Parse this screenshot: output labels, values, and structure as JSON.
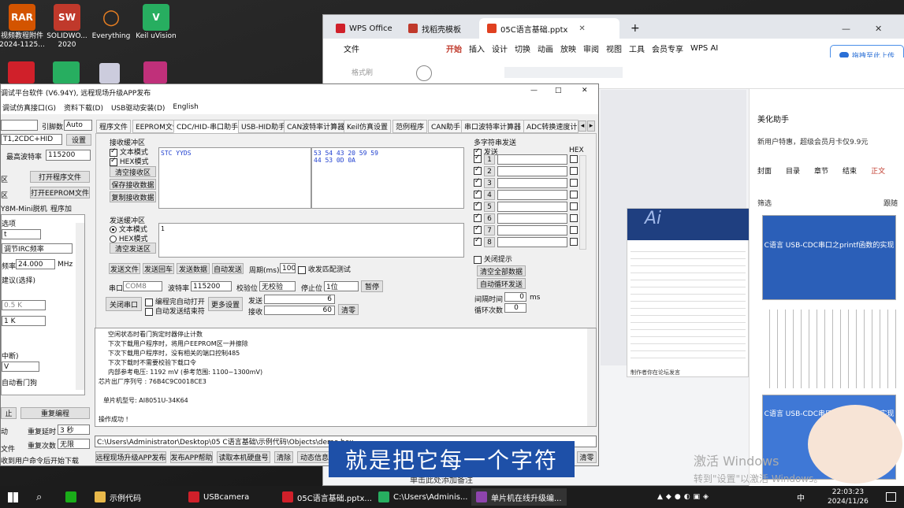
{
  "desktop": {
    "icons": [
      {
        "label": "视频教程附件\n2024-1125...",
        "color": "#d35400",
        "glyph": "RAR"
      },
      {
        "label": "SOLIDWO...\n2020",
        "color": "#c0392b",
        "glyph": "SW"
      },
      {
        "label": "Everything",
        "color": "#e67e22",
        "glyph": "Q"
      },
      {
        "label": "Keil uVision",
        "color": "#27ae60",
        "glyph": "V"
      }
    ]
  },
  "wps": {
    "tabs": [
      {
        "label": "WPS Office",
        "color": "#d0202a"
      },
      {
        "label": "找稻壳模板",
        "color": "#c0392b"
      },
      {
        "label": "05C语言基础.pptx",
        "color": "#e04020"
      }
    ],
    "menu": [
      "文件",
      "开始",
      "插入",
      "设计",
      "切换",
      "动画",
      "放映",
      "审阅",
      "视图",
      "工具",
      "会员专享",
      "WPS AI"
    ],
    "upload_button": "拖拽至此上传",
    "format_brush": "格式刷",
    "panel_title": "美化助手",
    "promo": "新用户特惠，超级会员月卡仅9.9元",
    "panel_tabs": [
      "封面",
      "目录",
      "章节",
      "结束",
      "正文"
    ],
    "filter": "筛选",
    "follow": "跟随",
    "thumb1": "C语言 USB-CDC串口之printf函数的实现",
    "thumb2": "C语言 USB-CDC串口之printf函数的实现",
    "add_note": "单击此处添加备注",
    "activate1": "激活 Windows",
    "activate2": "转到\"设置\"以激活 Windows。",
    "slide_text": "Ai",
    "slide_caption": "制作者你在论坛发言"
  },
  "stc": {
    "title": "调试平台软件 (V6.94Y), 远程现场升级APP发布",
    "menu": [
      "调试仿真接口(G)",
      "资料下载(D)",
      "USB驱动安装(D)",
      "English"
    ],
    "left": {
      "lead_count_label": "引脚数",
      "lead_count_value": "Auto",
      "port_value": "T1,2CDC+HID",
      "settings_button": "设置",
      "max_baud_label": "最高波特率",
      "max_baud_value": "115200",
      "open_program": "打开程序文件",
      "open_eeprom": "打开EEPROM文件",
      "mini_label": "Y8M-Mini脱机",
      "program_label": "程序加",
      "options_label": "选项",
      "irc_label": "调节IRC频率",
      "freq_label": "频率",
      "freq_value": "24.000",
      "freq_unit": "MHz",
      "suggest_label": "建议(选择)",
      "v1": "0.5 K",
      "v2": "1 K",
      "interrupt_label": "中断)",
      "vv": "V",
      "auto_label": "自动看门狗",
      "repeat_prog": "重复编程",
      "repeat_delay_label": "重复延时",
      "repeat_delay_value": "3 秒",
      "repeat_count_label": "重复次数",
      "repeat_count_value": "无限",
      "remote_label": "文件",
      "send_cmd": "收到用户命令后开始下载",
      "move_label": "动",
      "stop_label": "止"
    },
    "tabs": [
      "程序文件",
      "EEPROM文件",
      "CDC/HID-串口助手",
      "USB-HID助手",
      "CAN波特率计算器",
      "Keil仿真设置",
      "范例程序",
      "CAN助手",
      "串口波特率计算器",
      "ADC转换速度计算"
    ],
    "recv": {
      "title": "接收缓冲区",
      "text_mode": "文本模式",
      "hex_mode": "HEX模式",
      "clear": "清空接收区",
      "save": "保存接收数据",
      "copy": "复制接收数据",
      "text_content": "STC YYDS",
      "hex_line1": "53 54 43 20 59 59",
      "hex_line2": "44 53 0D 0A"
    },
    "send": {
      "title": "发送缓冲区",
      "text_mode": "文本模式",
      "hex_mode": "HEX模式",
      "clear": "清空发送区",
      "content": "1"
    },
    "actions": {
      "send_file": "发送文件",
      "send_enter": "发送回车",
      "send_data": "发送数据",
      "auto_send": "自动发送",
      "period_label": "周期(ms)",
      "period_value": "100",
      "match_label": "收发匹配测试"
    },
    "port": {
      "port_label": "串口",
      "port_value": "COM8",
      "baud_label": "波特率",
      "baud_value": "115200",
      "parity_label": "校验位",
      "parity_value": "无校验",
      "stop_label": "停止位",
      "stop_value": "1位",
      "pause": "暂停",
      "close_port": "关闭串口",
      "auto_open": "编程完自动打开",
      "auto_send_end": "自动发送结束符",
      "more": "更多设置",
      "sent_label": "发送",
      "sent_value": "6",
      "recv_label": "接收",
      "recv_value": "60",
      "clear": "清零"
    },
    "multi": {
      "title": "多字符串发送",
      "send_label": "发送",
      "hex_label": "HEX",
      "rows": [
        "1",
        "2",
        "3",
        "4",
        "5",
        "6",
        "7",
        "8"
      ],
      "close_hint": "关闭提示",
      "clear_all": "清空全部数据",
      "auto_loop": "自动循环发送",
      "interval_label": "间隔时间",
      "interval_value": "0",
      "interval_unit": "ms",
      "loop_label": "循环次数",
      "loop_value": "0"
    },
    "log": [
      "空闲状态时看门狗定时器停止计数",
      "下次下载用户程序时，将用户EEPROM区一并擦除",
      "下次下载用户程序时，没有相关的端口控制485",
      "下次下载时不需要校验下载口令",
      "内部参考电压: 1192 mV (参考范围: 1100~1300mV)",
      "芯片出厂序列号 : 76B4C9C0018CE3",
      "",
      "单片机型号: AI8051U-34K64",
      "",
      "操作成功 !"
    ],
    "path": "C:\\Users\\Administrator\\Desktop\\05 C语言基础\\示例代码\\Objects\\demo.hex",
    "bottom": [
      "远程现场升级APP发布",
      "发布APP帮助",
      "读取本机硬盘号",
      "清除",
      "动态信息"
    ],
    "clear_btn": "清零"
  },
  "subtitle": "就是把它每一个字符",
  "taskbar": {
    "items": [
      {
        "label": "示例代码",
        "color": "#e8b84a"
      },
      {
        "label": "USBcamera",
        "color": "#d0202a"
      },
      {
        "label": "05C语言基础.pptx...",
        "color": "#d0202a"
      },
      {
        "label": "C:\\Users\\Adminis...",
        "color": "#27ae60"
      },
      {
        "label": "单片机在线升级编...",
        "color": "#8e44ad"
      }
    ],
    "time": "22:03:23",
    "date": "2024/11/26",
    "ime": "中"
  }
}
